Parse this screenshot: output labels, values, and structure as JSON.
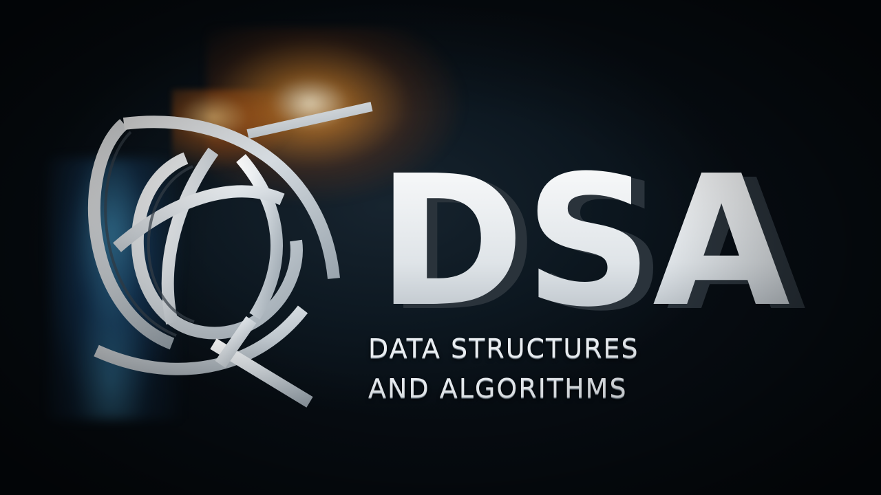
{
  "logo": {
    "mark": "DSA",
    "tagline_line1": "DATA STRUCTURES",
    "tagline_line2": "AND ALGORITHMS",
    "emblem_icon": "crossed-arcs-icon"
  },
  "colors": {
    "background": "#0b141c",
    "metal": "#e9edf1",
    "glow_orange": "#ff9a2a",
    "glow_blue": "#5ac8ff"
  }
}
